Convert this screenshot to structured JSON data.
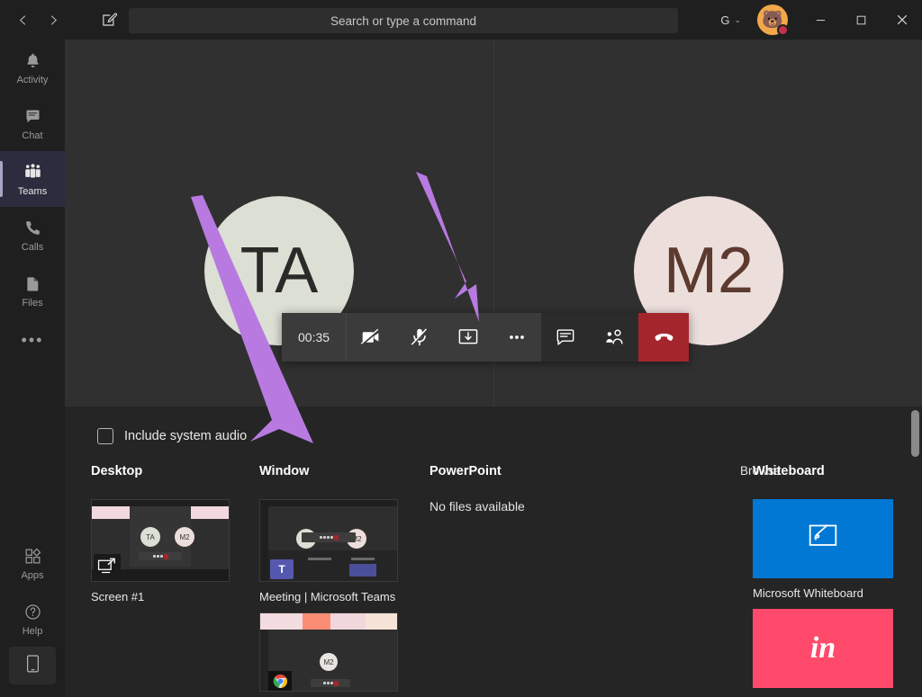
{
  "titlebar": {
    "back_label": "‹",
    "forward_label": "›",
    "compose_icon": "compose-icon",
    "search_placeholder": "Search or type a command",
    "tenant_label": "G",
    "tenant_caret": "⌄",
    "avatar_emoji": "🐻",
    "presence": "do-not-disturb",
    "minimize_label": "—",
    "maximize_label": "▢",
    "close_label": "✕"
  },
  "rail": {
    "items": [
      {
        "label": "Activity",
        "icon": "bell-icon",
        "active": false
      },
      {
        "label": "Chat",
        "icon": "chat-icon",
        "active": false
      },
      {
        "label": "Teams",
        "icon": "teams-icon",
        "active": true
      },
      {
        "label": "Calls",
        "icon": "phone-icon",
        "active": false
      },
      {
        "label": "Files",
        "icon": "file-icon",
        "active": false
      }
    ],
    "more_label": "•••",
    "bottom_items": [
      {
        "label": "Apps",
        "icon": "apps-icon"
      },
      {
        "label": "Help",
        "icon": "help-icon"
      }
    ],
    "mobile_icon": "mobile-phone-icon"
  },
  "stage": {
    "participants": [
      {
        "initials": "TA",
        "bg": "#dcdfd3",
        "fg": "#2a2a28"
      },
      {
        "initials": "M2",
        "bg": "#ecdedb",
        "fg": "#5d3a2e"
      }
    ]
  },
  "callbar": {
    "timer": "00:35",
    "buttons": [
      {
        "name": "camera-off-button",
        "icon": "camera-off-icon"
      },
      {
        "name": "mic-off-button",
        "icon": "mic-off-icon"
      },
      {
        "name": "share-screen-button",
        "icon": "share-screen-icon"
      },
      {
        "name": "more-actions-button",
        "icon": "ellipsis-icon"
      },
      {
        "name": "chat-button",
        "icon": "chat-bubble-icon"
      },
      {
        "name": "participants-button",
        "icon": "people-icon"
      }
    ],
    "hangup": {
      "name": "hangup-button",
      "icon": "phone-hangup-icon",
      "color": "#a4262c"
    }
  },
  "tray": {
    "system_audio_label": "Include system audio",
    "system_audio_checked": false,
    "columns": {
      "desktop": {
        "title": "Desktop",
        "items": [
          {
            "label": "Screen #1",
            "badge": "screen-share-icon"
          }
        ]
      },
      "window": {
        "title": "Window",
        "items": [
          {
            "label": "Meeting | Microsoft Teams",
            "badge": "teams-logo-icon"
          },
          {
            "label": "",
            "badge": "chrome-logo-icon"
          }
        ]
      },
      "powerpoint": {
        "title": "PowerPoint",
        "browse_label": "Browse",
        "empty_text": "No files available"
      },
      "whiteboard": {
        "title": "Whiteboard",
        "items": [
          {
            "label": "Microsoft Whiteboard",
            "color": "#0078d4",
            "icon": "whiteboard-pen-icon"
          },
          {
            "label": "",
            "color": "#ff4a6b",
            "icon": "invision-freehand-icon"
          }
        ]
      }
    }
  },
  "annotations": {
    "arrow_color": "#b87ae0",
    "arrows": [
      {
        "name": "arrow-pointing-to-share-tray",
        "target": "share-tray"
      },
      {
        "name": "arrow-pointing-to-share-button",
        "target": "share-screen-button"
      }
    ]
  }
}
